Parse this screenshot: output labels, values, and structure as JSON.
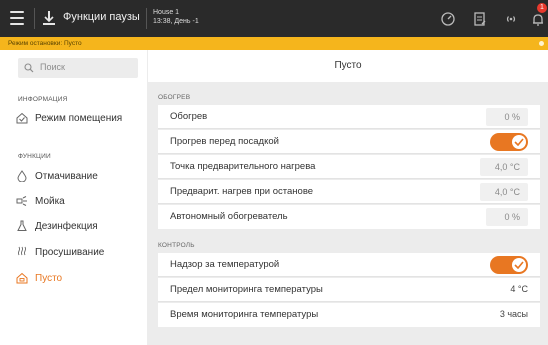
{
  "topbar": {
    "title": "Функции паузы",
    "house_name": "House 1",
    "datetime": "13:38, День -1",
    "badge_count": "1",
    "icons": [
      "menu-icon",
      "pause-icon",
      "gauge-icon",
      "document-icon",
      "signal-icon",
      "bell-icon"
    ]
  },
  "alert": {
    "text": "Режим остановки: Пусто",
    "color": "#f5b51c"
  },
  "sidebar": {
    "search_placeholder": "Поиск",
    "sections": [
      {
        "title": "ИНФОРМАЦИЯ"
      },
      {
        "title": "ФУНКЦИИ"
      }
    ],
    "items": [
      {
        "label": "Режим помещения",
        "icon": "room-mode-icon",
        "active": false
      },
      {
        "label": "Отмачивание",
        "icon": "droplet-icon",
        "active": false
      },
      {
        "label": "Мойка",
        "icon": "spray-icon",
        "active": false
      },
      {
        "label": "Дезинфекция",
        "icon": "flask-icon",
        "active": false
      },
      {
        "label": "Просушивание",
        "icon": "heat-waves-icon",
        "active": false
      },
      {
        "label": "Пусто",
        "icon": "empty-house-icon",
        "active": true
      }
    ]
  },
  "main": {
    "title": "Пусто",
    "sections": [
      {
        "title": "ОБОГРЕВ",
        "rows": [
          {
            "label": "Обогрев",
            "value": "0 %"
          },
          {
            "label": "Прогрев перед посадкой",
            "toggle": true
          },
          {
            "label": "Точка предварительного нагрева",
            "value": "4,0 °C"
          },
          {
            "label": "Предварит. нагрев при останове",
            "value": "4,0 °C"
          },
          {
            "label": "Автономный обогреватель",
            "value": "0 %"
          }
        ]
      },
      {
        "title": "КОНТРОЛЬ",
        "rows": [
          {
            "label": "Надзор за температурой",
            "toggle": true
          },
          {
            "label": "Предел мониторинга температуры",
            "value": "4 °C"
          },
          {
            "label": "Время мониторинга температуры",
            "value": "3 часы"
          }
        ]
      }
    ]
  },
  "colors": {
    "accent": "#e87722",
    "topbar": "#2a2a2a",
    "background": "#ececec"
  }
}
